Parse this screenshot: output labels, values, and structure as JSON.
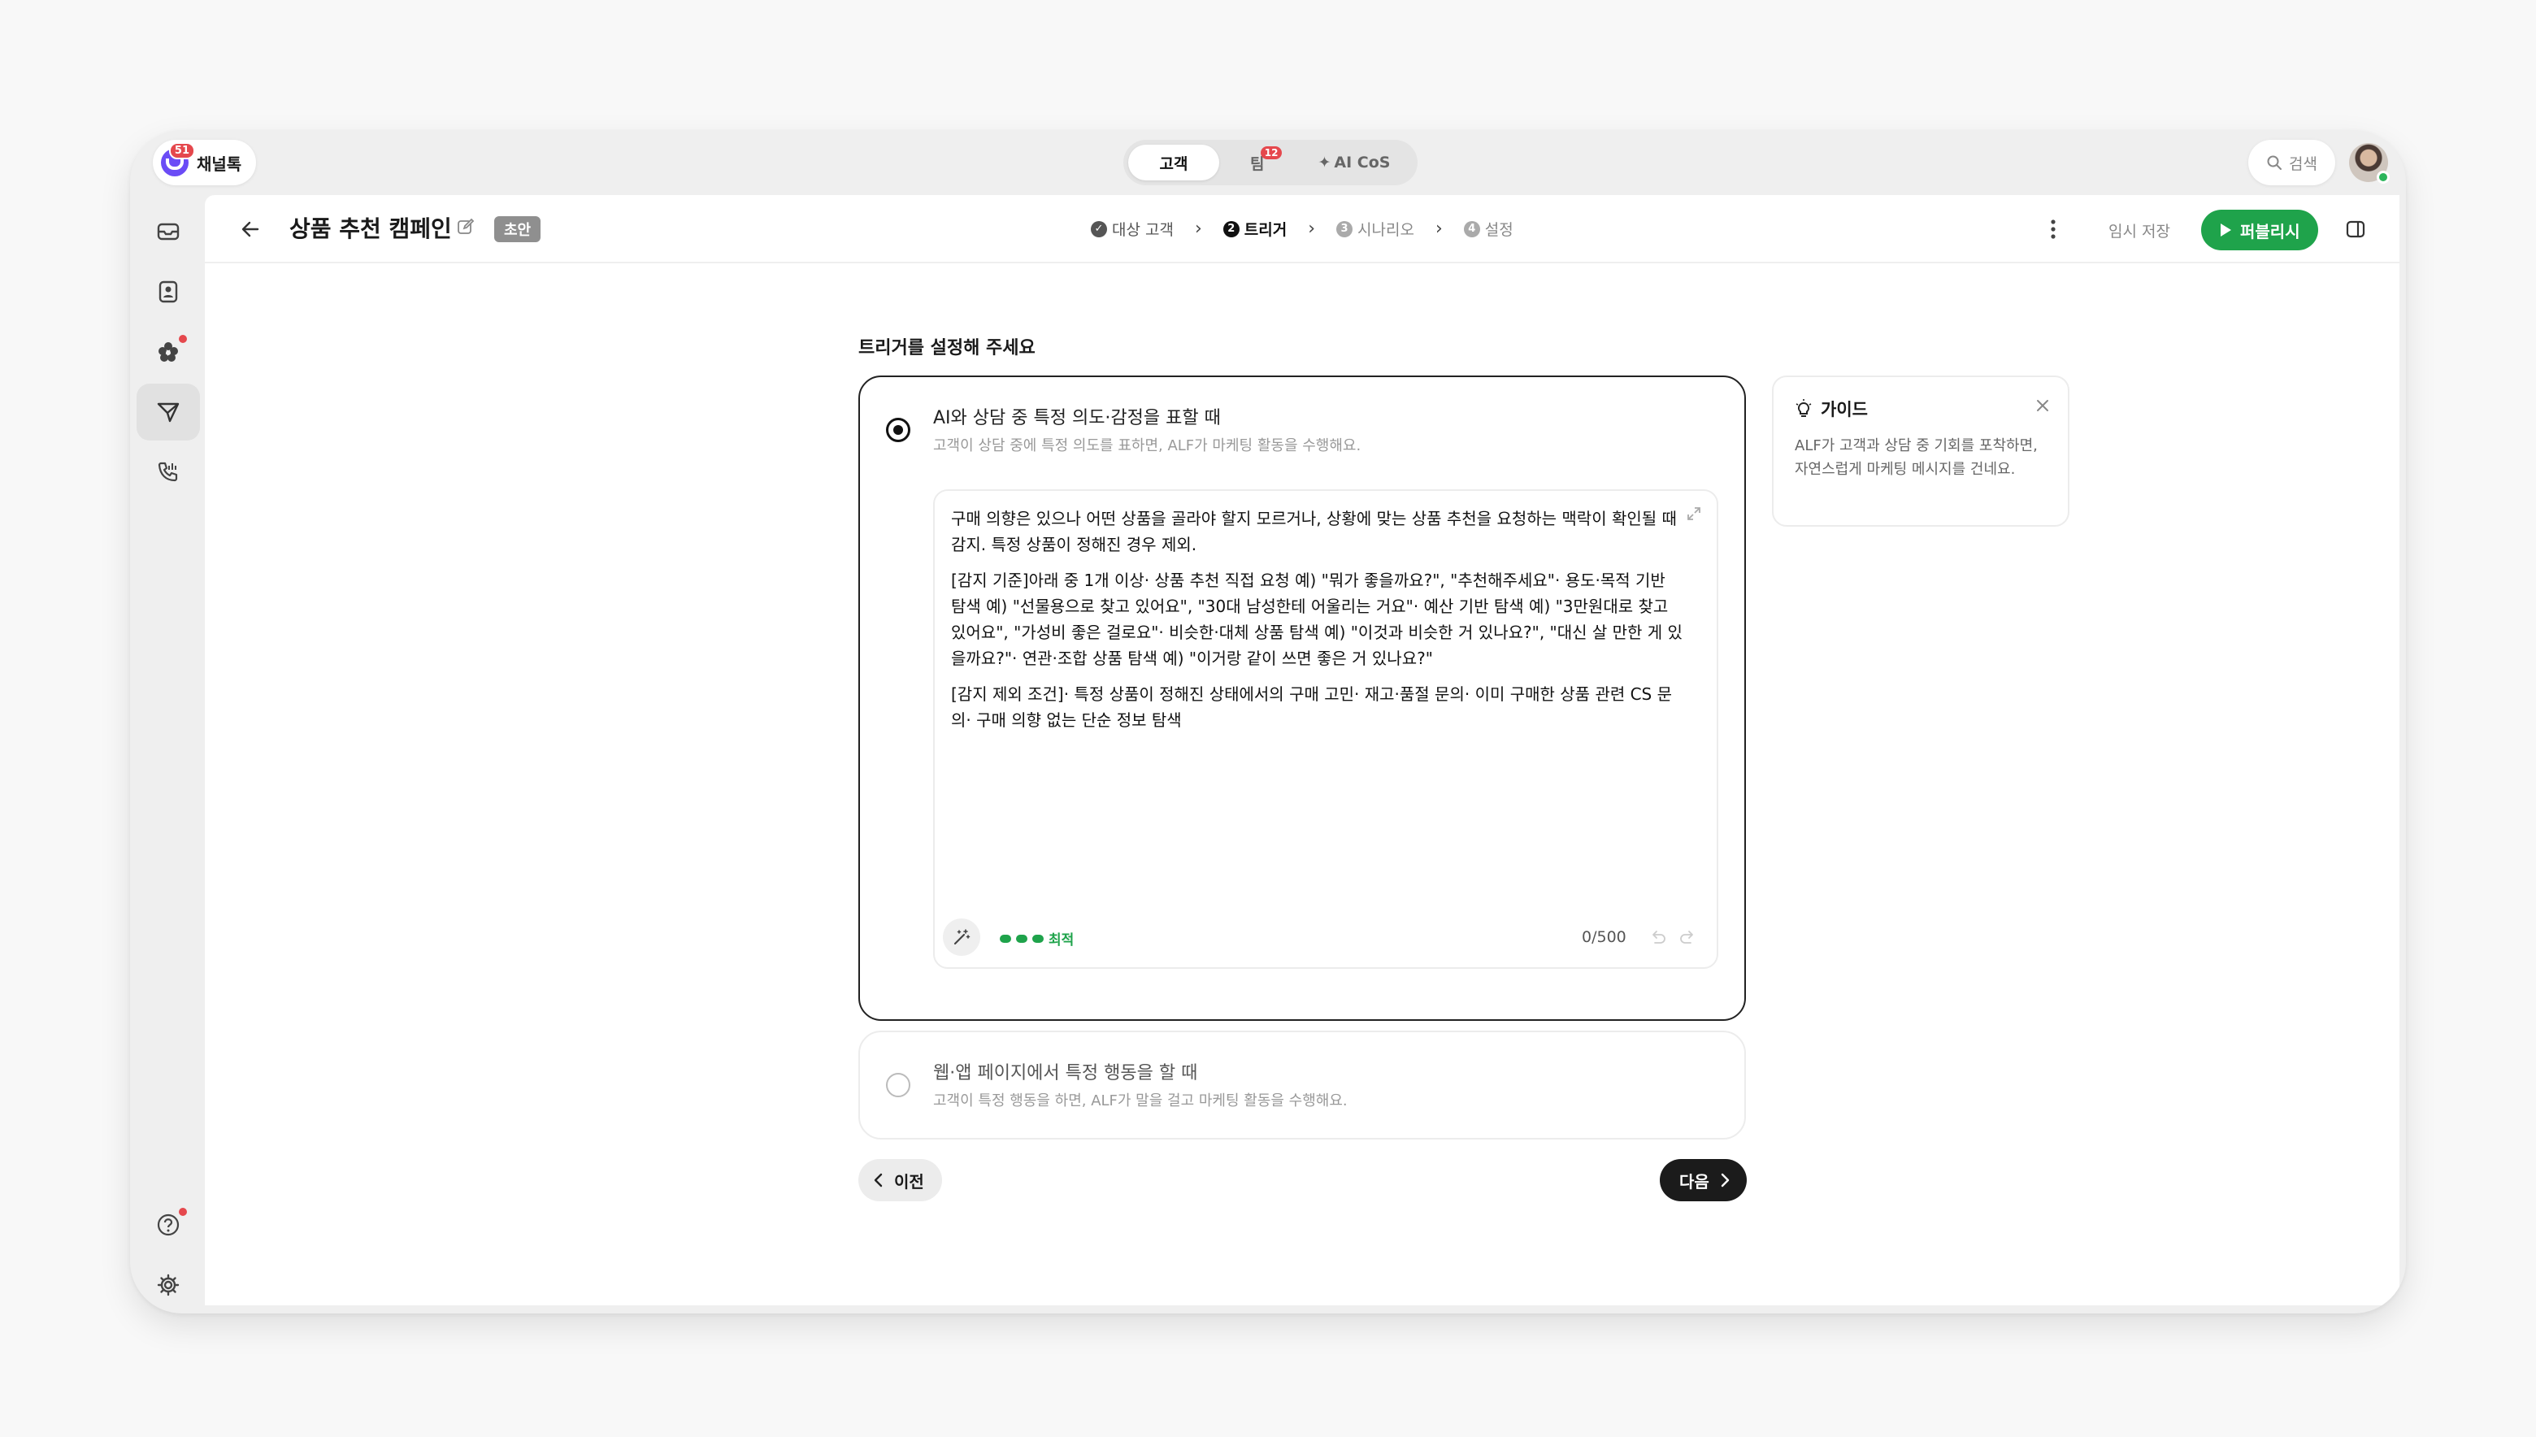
{
  "brand": {
    "name": "채널톡",
    "badge": "51"
  },
  "top_tabs": [
    {
      "label": "고객",
      "active": true
    },
    {
      "label": "팀",
      "badge": "12"
    },
    {
      "label": "AI CoS"
    }
  ],
  "search": {
    "label": "검색"
  },
  "header": {
    "title": "상품 추천 캠페인",
    "badge": "초안",
    "save_label": "임시 저장",
    "publish_label": "퍼블리시"
  },
  "steps": [
    {
      "num": "✓",
      "label": "대상 고객",
      "state": "done"
    },
    {
      "num": "2",
      "label": "트리거",
      "state": "current"
    },
    {
      "num": "3",
      "label": "시나리오",
      "state": "todo"
    },
    {
      "num": "4",
      "label": "설정",
      "state": "todo"
    }
  ],
  "section_title": "트리거를 설정해 주세요",
  "option_ai": {
    "title": "AI와 상담 중 특정 의도·감정을 표할 때",
    "desc": "고객이 상담 중에 특정 의도를 표하면, ALF가 마케팅 활동을 수행해요.",
    "editor": {
      "p1": "구매 의향은 있으나 어떤 상품을 골라야 할지 모르거나, 상황에 맞는 상품 추천을 요청하는 맥락이 확인될 때 감지. 특정 상품이 정해진 경우 제외.",
      "p2": "[감지 기준]아래 중 1개 이상· 상품 추천 직접 요청 예) \"뭐가 좋을까요?\", \"추천해주세요\"· 용도·목적 기반 탐색 예) \"선물용으로 찾고 있어요\", \"30대 남성한테 어울리는 거요\"· 예산 기반 탐색 예) \"3만원대로 찾고 있어요\", \"가성비 좋은 걸로요\"· 비슷한·대체 상품 탐색 예) \"이것과 비슷한 거 있나요?\", \"대신 살 만한 게 있을까요?\"· 연관·조합 상품 탐색 예) \"이거랑 같이 쓰면 좋은 거 있나요?\"",
      "p3": "[감지 제외 조건]· 특정 상품이 정해진 상태에서의 구매 고민· 재고·품절 문의· 이미 구매한 상품 관련 CS 문의· 구매 의향 없는 단순 정보 탐색",
      "quality": "최적",
      "counter": "0/500"
    }
  },
  "option_web": {
    "title": "웹·앱 페이지에서 특정 행동을 할 때",
    "desc": "고객이 특정 행동을 하면, ALF가 말을 걸고 마케팅 활동을 수행해요."
  },
  "buttons": {
    "prev": "이전",
    "next": "다음"
  },
  "guide": {
    "title": "가이드",
    "body": "ALF가 고객과 상담 중 기회를 포착하면, 자연스럽게 마케팅 메시지를 건네요."
  },
  "colors": {
    "accent": "#1fa34b",
    "brand": "#6b4cf6",
    "alert": "#e5484d"
  }
}
